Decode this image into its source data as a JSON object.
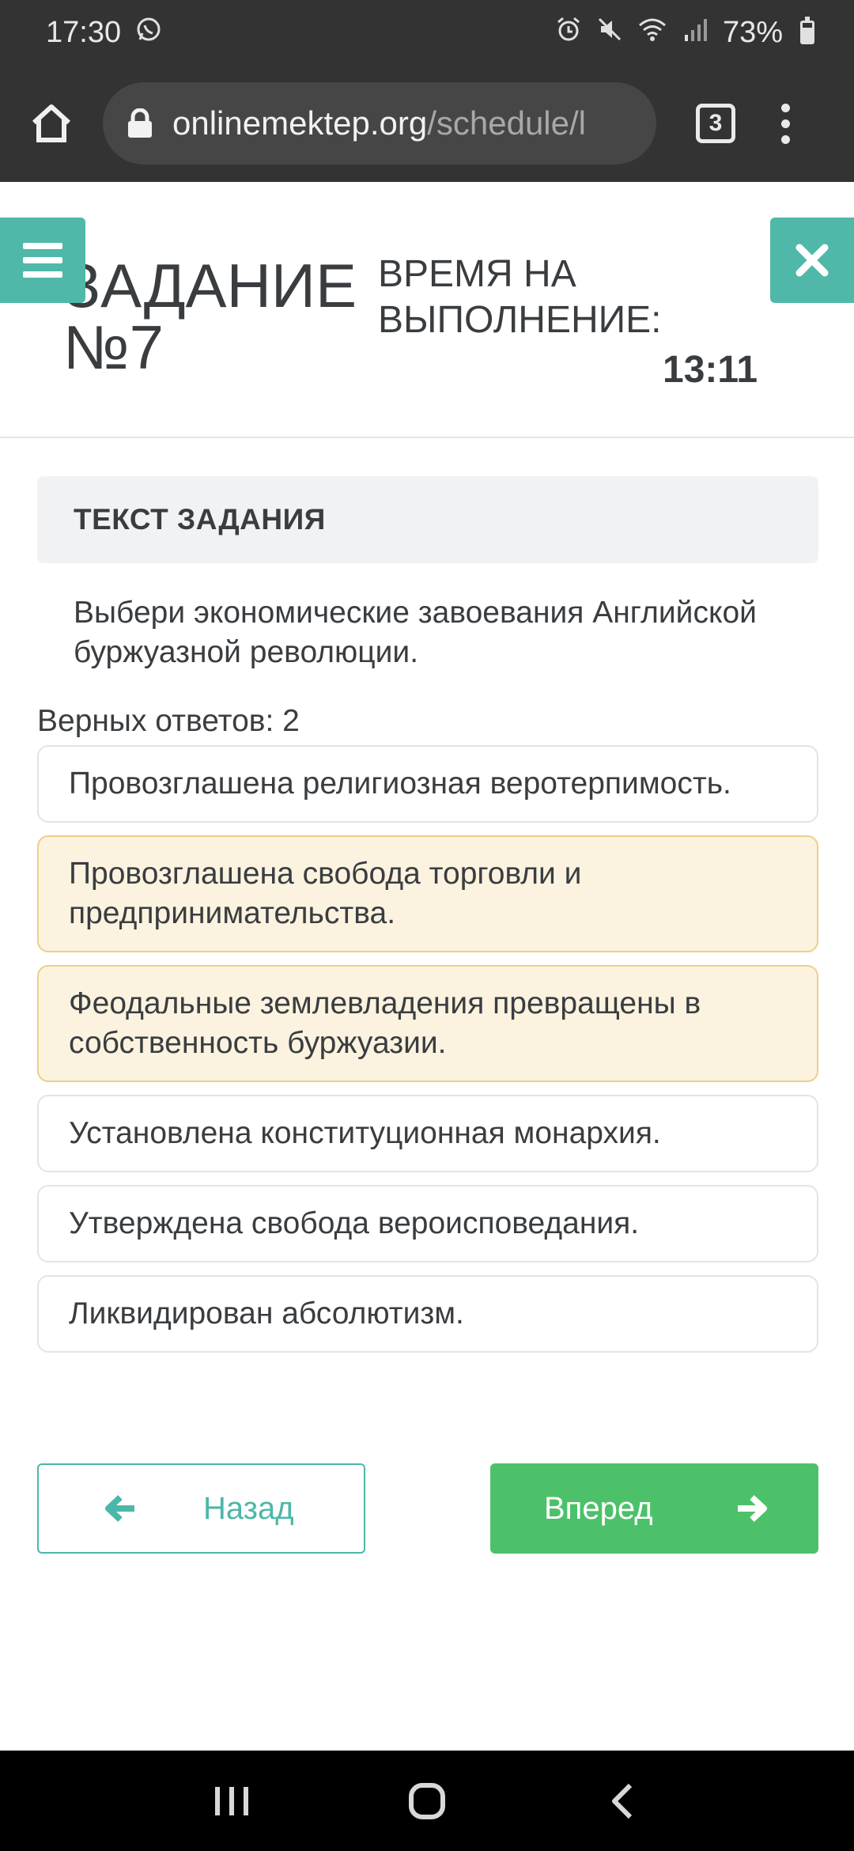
{
  "status_bar": {
    "time": "17:30",
    "left_icons": [
      "whatsapp-icon"
    ],
    "right_icons": [
      "alarm-icon",
      "mute-icon",
      "wifi-icon",
      "signal-icon"
    ],
    "battery": "73%",
    "battery_level": 0.73
  },
  "browser": {
    "url_domain": "onlinemektep.org",
    "url_path": "/schedule/l",
    "tab_count": "3"
  },
  "header": {
    "task_title_line1": "ЗАДАНИЕ",
    "task_title_line2": "№7",
    "time_label_line1": "ВРЕМЯ НА",
    "time_label_line2": "ВЫПОЛНЕНИЕ:",
    "time_value": "13:11"
  },
  "task": {
    "panel_title": "ТЕКСТ ЗАДАНИЯ",
    "question": "Выбери экономические завоевания Английской буржуазной революции.",
    "correct_count": "Верных ответов: 2"
  },
  "options": [
    {
      "label": "Провозглашена религиозная веротерпимость.",
      "selected": false
    },
    {
      "label": "Провозглашена свобода торговли и предпринимательства.",
      "selected": true
    },
    {
      "label": "Феодальные землевладения превращены в собственность буржуазии.",
      "selected": true
    },
    {
      "label": "Установлена конституционная монархия.",
      "selected": false
    },
    {
      "label": "Утверждена свобода вероисповедания.",
      "selected": false
    },
    {
      "label": "Ликвидирован абсолютизм.",
      "selected": false
    }
  ],
  "navigation": {
    "back_label": "Назад",
    "next_label": "Вперед"
  },
  "colors": {
    "accent_teal": "#50b8a8",
    "next_green": "#4cc16a",
    "selected_bg": "#fbf3df",
    "selected_border": "#ecd089"
  }
}
